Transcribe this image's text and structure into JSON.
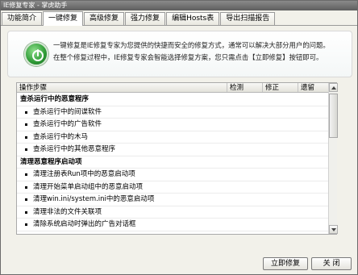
{
  "window": {
    "title": "IE修复专家 - 掌虎助手"
  },
  "tabs": [
    {
      "label": "功能简介",
      "active": false
    },
    {
      "label": "一键修复",
      "active": true
    },
    {
      "label": "高级修复",
      "active": false
    },
    {
      "label": "强力修复",
      "active": false
    },
    {
      "label": "编辑Hosts表",
      "active": false
    },
    {
      "label": "导出扫描报告",
      "active": false
    }
  ],
  "intro": {
    "line1": "一键修复是IE修复专家为您提供的快捷而安全的修复方式，通常可以解决大部分用户的问题。",
    "line2": "在整个修复过程中，IE修复专家会智能选择修复方案，您只需点击【立即修复】按钮即可。"
  },
  "list": {
    "columns": [
      "操作步骤",
      "检测",
      "修正",
      "遗留"
    ],
    "groups": [
      {
        "title": "查杀运行中的恶意程序",
        "items": [
          "查杀运行中的间谍软件",
          "查杀运行中的广告软件",
          "查杀运行中的木马",
          "查杀运行中的其他恶意程序"
        ]
      },
      {
        "title": "清理恶意程序启动项",
        "items": [
          "清理注册表Run项中的恶意启动项",
          "清理开始菜单启动组中的恶意启动项",
          "清理win.ini/system.ini中的恶意启动项",
          "清理非法的文件关联项",
          "清除系统启动时弹出的广告对话框"
        ]
      }
    ]
  },
  "buttons": {
    "fix": "立即修复",
    "close": "关 闭"
  },
  "colors": {
    "logo": "#2d9a35",
    "titlebar": "#6e6e6e"
  }
}
